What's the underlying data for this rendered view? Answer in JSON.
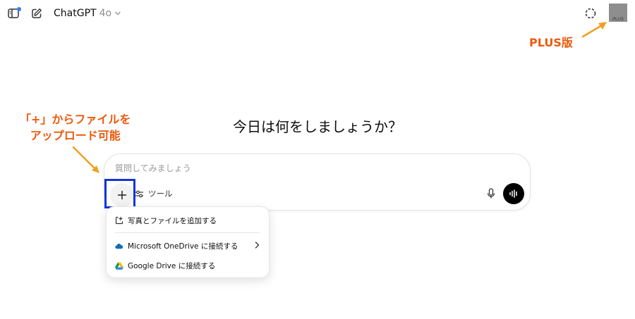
{
  "header": {
    "model_name": "ChatGPT",
    "model_version": "4o",
    "plan_badge": "PLUS"
  },
  "annotations": {
    "plus_version": "PLUS版",
    "upload_line1": "「+」からファイルを",
    "upload_line2": "アップロード可能"
  },
  "main": {
    "greeting": "今日は何をしましょうか？"
  },
  "composer": {
    "placeholder": "質問してみましょう",
    "tools_label": "ツール"
  },
  "attach_menu": {
    "items": [
      {
        "label": "写真とファイルを追加する",
        "icon": "photo-file-icon"
      },
      {
        "label": "Microsoft OneDrive に接続する",
        "icon": "onedrive-icon"
      },
      {
        "label": "Google Drive に接続する",
        "icon": "google-drive-icon"
      }
    ]
  },
  "colors": {
    "annotation": "#ec5a0d",
    "highlight": "#1235d8",
    "notification_dot": "#2f7ef5"
  }
}
